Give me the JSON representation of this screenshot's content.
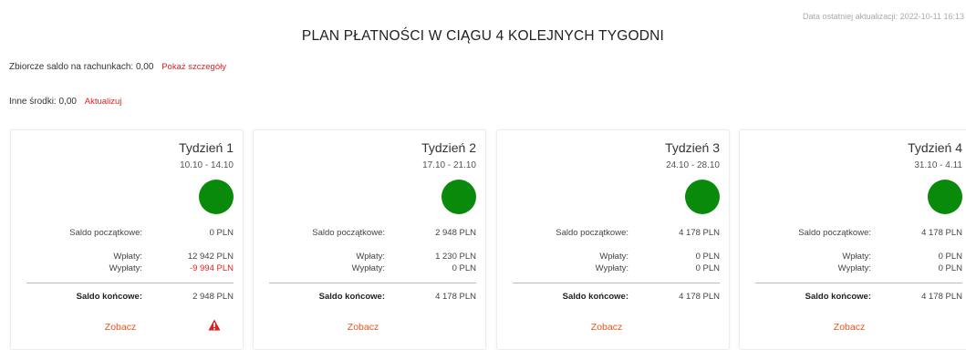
{
  "header": {
    "last_update": "Data ostatniej aktualizacji: 2022-10-11 16:13",
    "title": "PLAN PŁATNOŚCI W CIĄGU 4 KOLEJNYCH TYGODNI"
  },
  "summary": {
    "balance_label": "Zbiorcze saldo na rachunkach:",
    "balance_value": "0,00",
    "balance_link": "Pokaż szczegóły",
    "other_label": "Inne środki:",
    "other_value": "0,00",
    "other_link": "Aktualizuj"
  },
  "labels": {
    "opening": "Saldo początkowe:",
    "inflows": "Wpłaty:",
    "outflows": "Wypłaty:",
    "closing": "Saldo końcowe:",
    "see": "Zobacz"
  },
  "status_color": "#0a8a0a",
  "weeks": [
    {
      "title": "Tydzień 1",
      "range": "10.10 - 14.10",
      "opening": "0 PLN",
      "inflows": "12 942 PLN",
      "outflows": "-9 994 PLN",
      "closing": "2 948 PLN",
      "warning": true
    },
    {
      "title": "Tydzień 2",
      "range": "17.10 - 21.10",
      "opening": "2 948 PLN",
      "inflows": "1 230 PLN",
      "outflows": "0 PLN",
      "closing": "4 178 PLN",
      "warning": false
    },
    {
      "title": "Tydzień 3",
      "range": "24.10 - 28.10",
      "opening": "4 178 PLN",
      "inflows": "0 PLN",
      "outflows": "0 PLN",
      "closing": "4 178 PLN",
      "warning": false
    },
    {
      "title": "Tydzień 4",
      "range": "31.10 - 4.11",
      "opening": "4 178 PLN",
      "inflows": "0 PLN",
      "outflows": "0 PLN",
      "closing": "4 178 PLN",
      "warning": false
    }
  ]
}
